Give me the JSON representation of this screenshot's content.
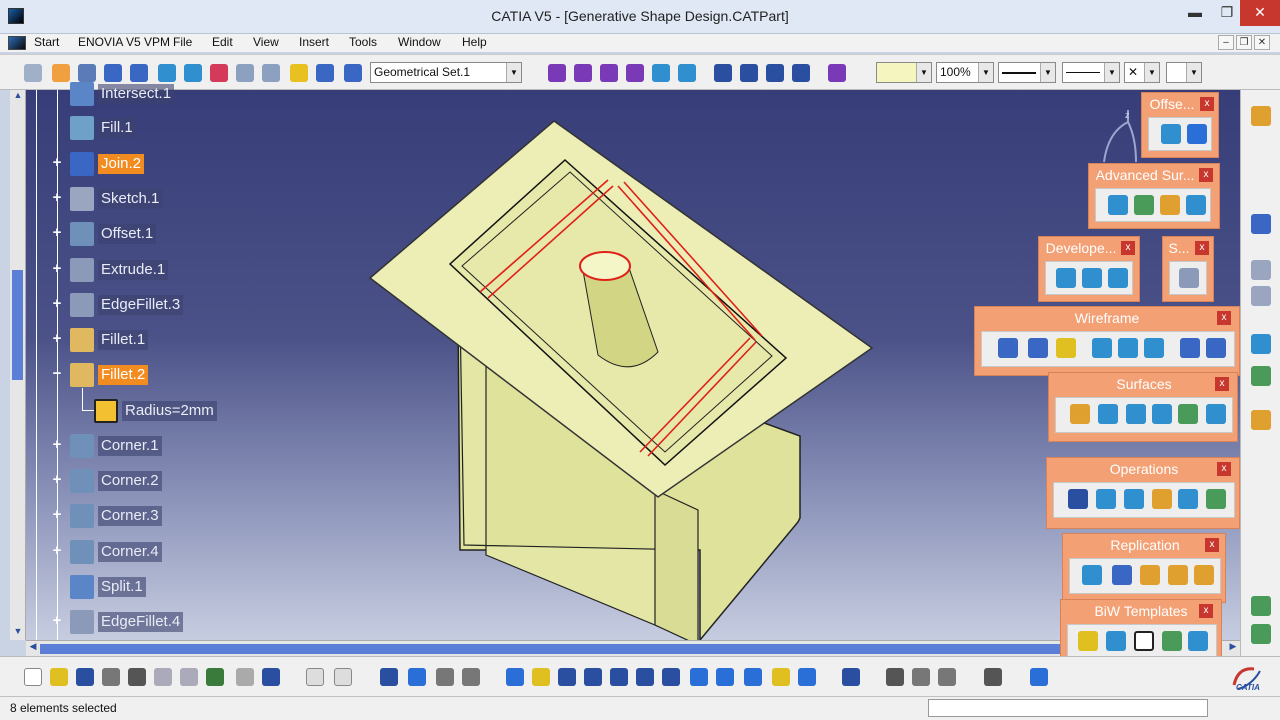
{
  "window": {
    "title": "CATIA V5 - [Generative Shape Design.CATPart]",
    "minimize_glyph": "▬",
    "maximize_glyph": "❐",
    "close_glyph": "✕"
  },
  "menu": {
    "items": [
      "Start",
      "ENOVIA V5 VPM",
      "File",
      "Edit",
      "View",
      "Insert",
      "Tools",
      "Window",
      "Help"
    ],
    "doc_controls": [
      "‒",
      "❐",
      "✕"
    ]
  },
  "toolbar_top": {
    "geometrical_set": "Geometrical Set.1",
    "zoom": "100%",
    "color_value": "",
    "layer_value": "",
    "close_x": "✕"
  },
  "spec_tree": {
    "items": [
      {
        "label": "Intersect.1",
        "expandable": false,
        "selected": false,
        "icon": "intersect-icon"
      },
      {
        "label": "Fill.1",
        "expandable": false,
        "selected": false,
        "icon": "fill-icon"
      },
      {
        "label": "Join.2",
        "expandable": true,
        "selected": true,
        "icon": "join-icon"
      },
      {
        "label": "Sketch.1",
        "expandable": true,
        "selected": false,
        "icon": "sketch-icon"
      },
      {
        "label": "Offset.1",
        "expandable": true,
        "selected": false,
        "icon": "offset-icon"
      },
      {
        "label": "Extrude.1",
        "expandable": true,
        "selected": false,
        "icon": "extrude-icon"
      },
      {
        "label": "EdgeFillet.3",
        "expandable": true,
        "selected": false,
        "icon": "edge-fillet-icon"
      },
      {
        "label": "Fillet.1",
        "expandable": true,
        "selected": false,
        "icon": "fillet-icon"
      },
      {
        "label": "Fillet.2",
        "expandable": true,
        "selected": true,
        "icon": "fillet-icon",
        "expanded": true
      },
      {
        "label": "Corner.1",
        "expandable": true,
        "selected": false,
        "icon": "corner-icon"
      },
      {
        "label": "Corner.2",
        "expandable": true,
        "selected": false,
        "icon": "corner-icon"
      },
      {
        "label": "Corner.3",
        "expandable": true,
        "selected": false,
        "icon": "corner-icon"
      },
      {
        "label": "Corner.4",
        "expandable": true,
        "selected": false,
        "icon": "corner-icon"
      },
      {
        "label": "Split.1",
        "expandable": false,
        "selected": false,
        "icon": "split-icon"
      },
      {
        "label": "EdgeFillet.4",
        "expandable": true,
        "selected": false,
        "icon": "edge-fillet-icon"
      }
    ],
    "param": "Radius=2mm"
  },
  "palettes": {
    "offset": {
      "title": "Offse...",
      "close": "x"
    },
    "advanced_surfaces": {
      "title": "Advanced Sur...",
      "close": "x"
    },
    "developed": {
      "title": "Develope...",
      "close": "x"
    },
    "s": {
      "title": "S...",
      "close": "x"
    },
    "wireframe": {
      "title": "Wireframe",
      "close": "x"
    },
    "surfaces": {
      "title": "Surfaces",
      "close": "x"
    },
    "operations": {
      "title": "Operations",
      "close": "x"
    },
    "replication": {
      "title": "Replication",
      "close": "x"
    },
    "biw_templates": {
      "title": "BiW Templates",
      "close": "x"
    }
  },
  "status": {
    "text": "8 elements selected"
  },
  "brand": {
    "logo_text": "CATIA"
  },
  "colors": {
    "viewport_top": "#373d78",
    "viewport_bottom": "#c7cde0",
    "part_face": "#e6e9a8",
    "selection": "#f28c21",
    "palette": "#f3a074",
    "close_button": "#c8372d",
    "highlight_edge": "#e0201a"
  }
}
